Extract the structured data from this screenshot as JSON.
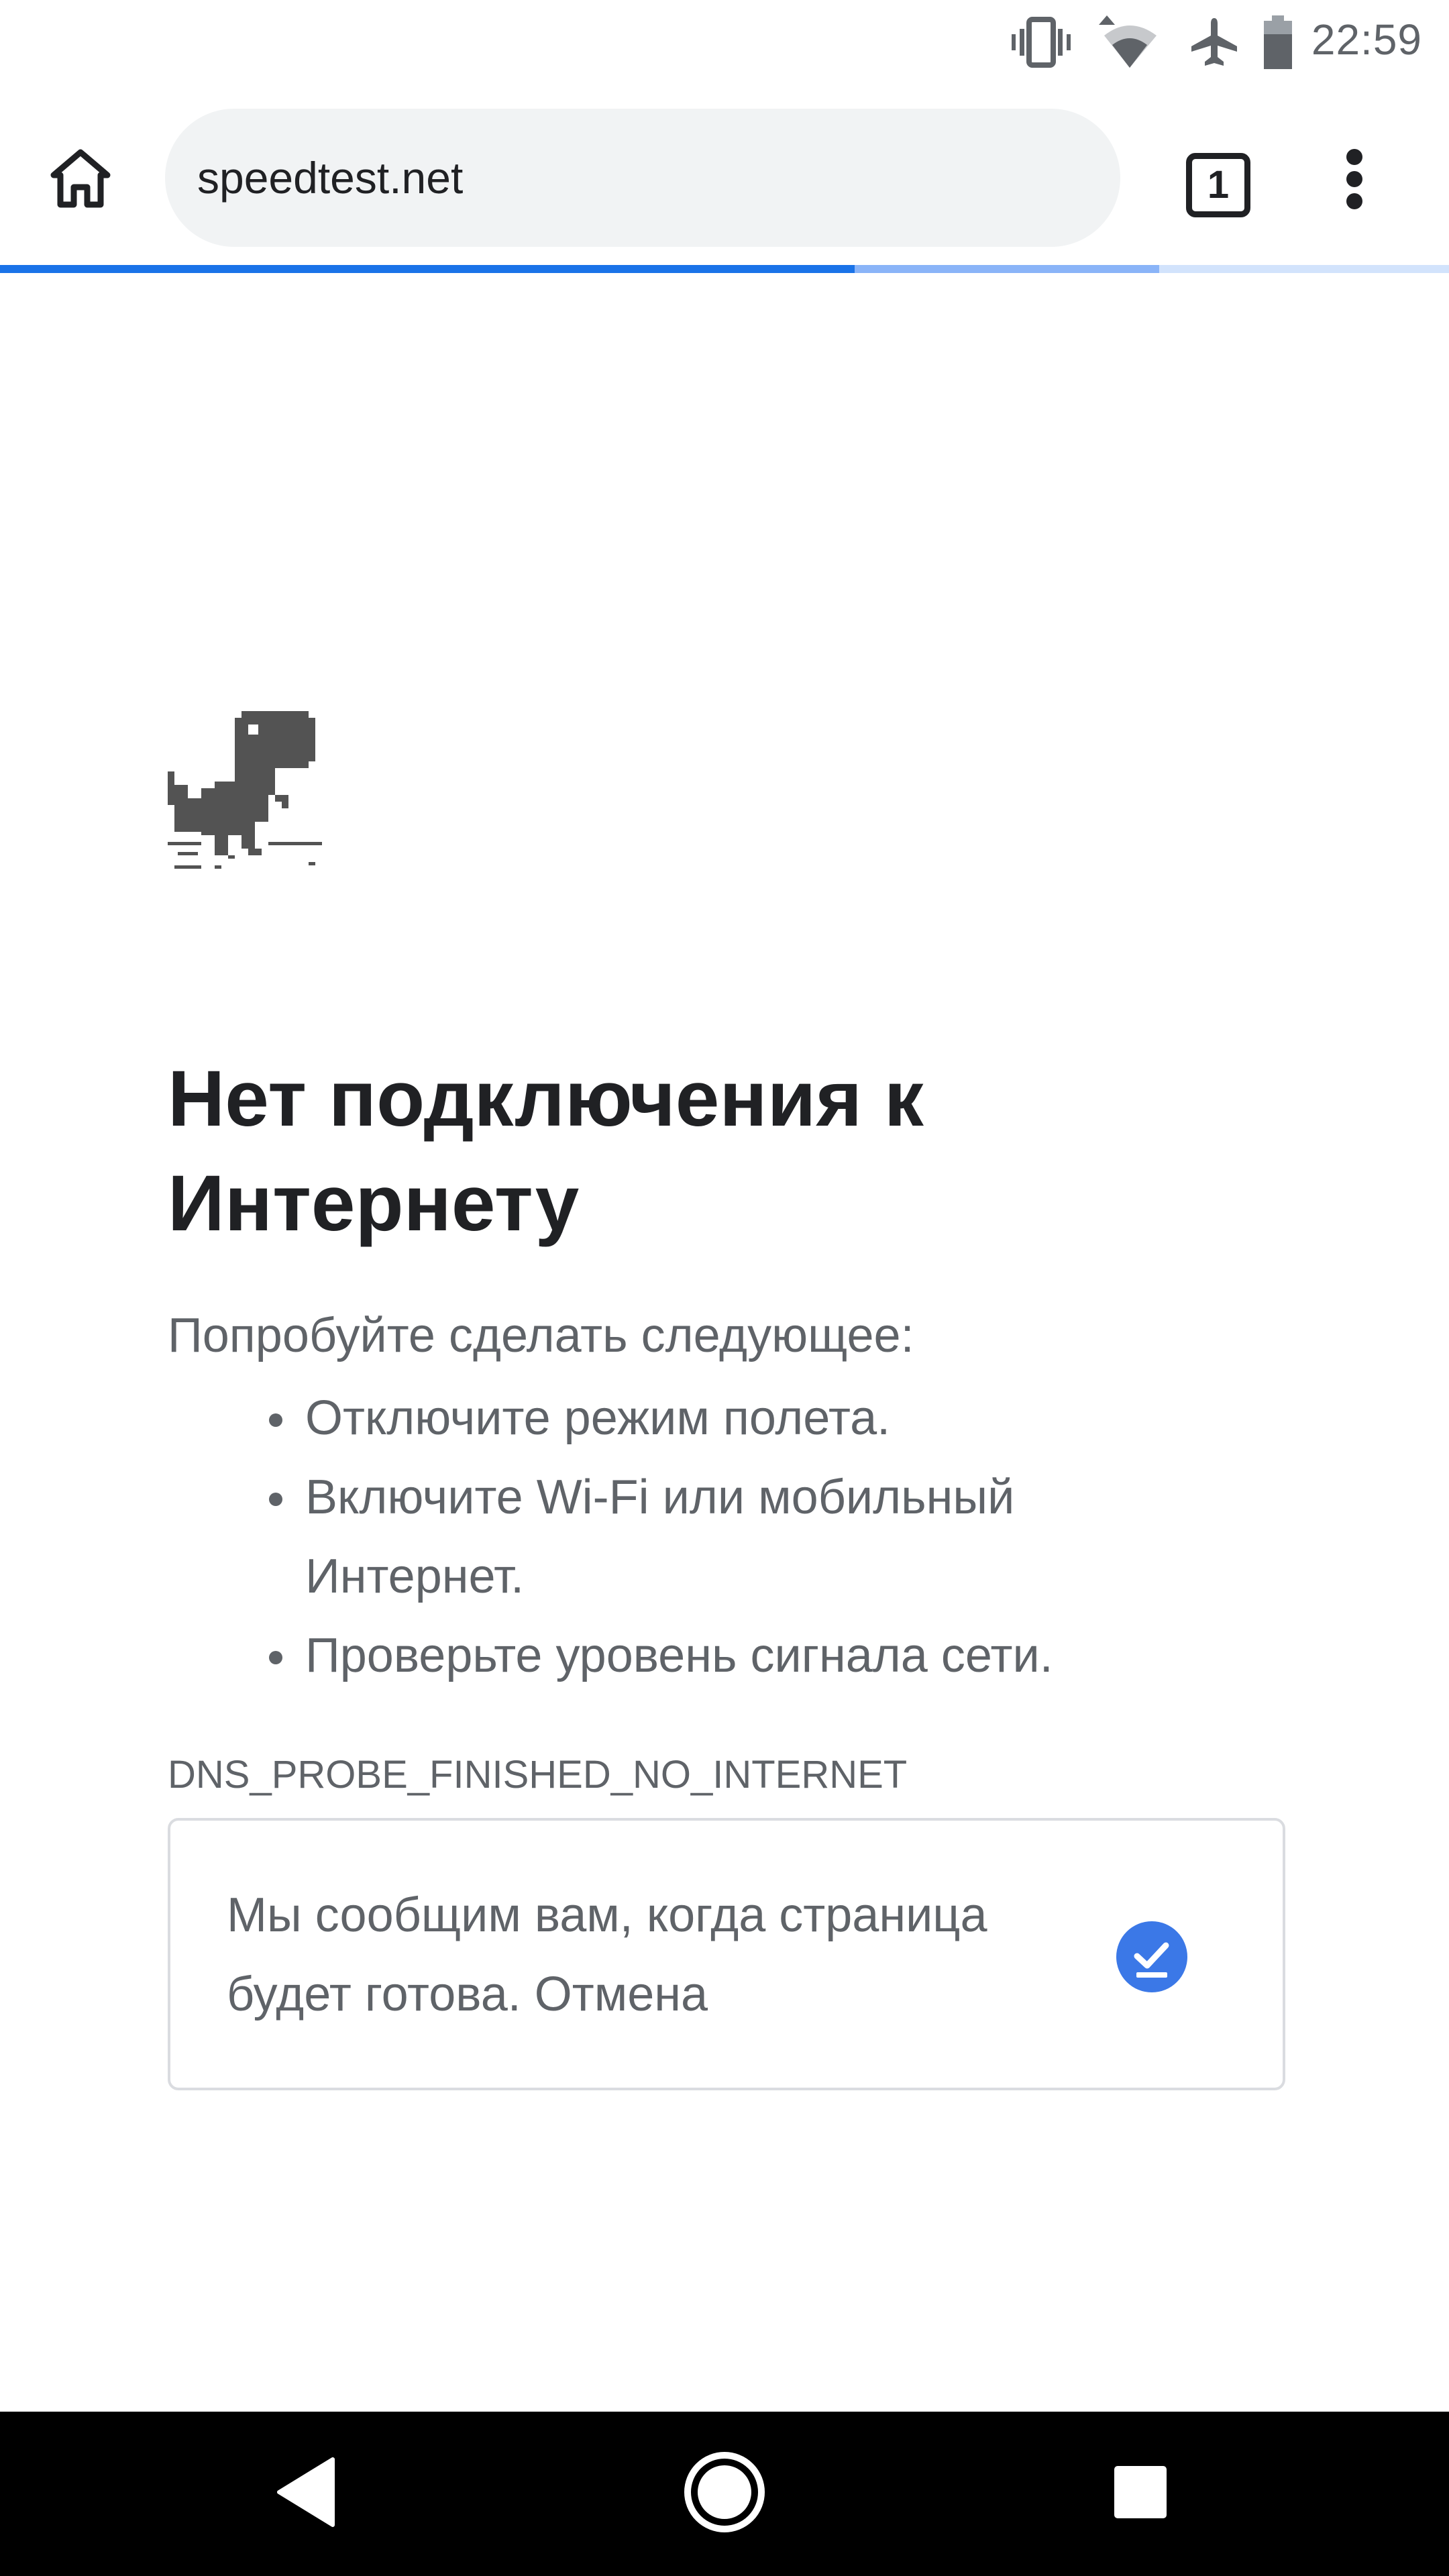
{
  "status_bar": {
    "time": "22:59",
    "icons": [
      "vibrate-icon",
      "wifi-icon",
      "airplane-mode-icon",
      "battery-icon"
    ]
  },
  "toolbar": {
    "url": "speedtest.net",
    "tab_count": "1",
    "home_icon": "home-icon",
    "menu_icon": "more-vert-icon"
  },
  "progress": {
    "value": 0.59,
    "buffer": 0.8
  },
  "error_page": {
    "title": "Нет подключения к Интернету",
    "suggestions_intro": "Попробуйте сделать следующее:",
    "suggestions": [
      "Отключите режим полета.",
      "Включите Wi-Fi или мобильный Интернет.",
      "Проверьте уровень сигнала сети."
    ],
    "error_code": "DNS_PROBE_FINISHED_NO_INTERNET",
    "notify_text": "Мы сообщим вам, когда страница будет готова.",
    "notify_cancel": "Отмена"
  },
  "colors": {
    "accent": "#1a73e8",
    "check_badge": "#3b78e7",
    "text_primary": "#202124",
    "text_secondary": "#5f6368"
  },
  "nav_bar": {
    "icons": [
      "back-icon",
      "home-circle-icon",
      "recents-icon"
    ]
  }
}
